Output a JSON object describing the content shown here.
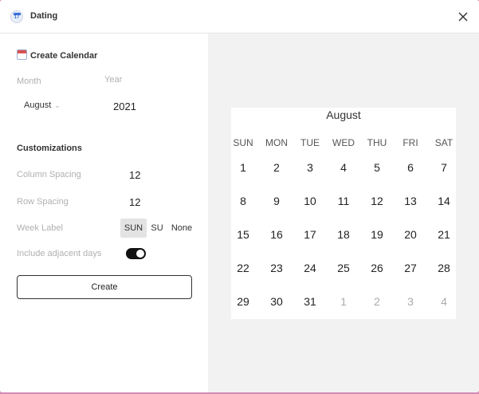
{
  "window": {
    "title": "Dating",
    "app_icon_text": "17"
  },
  "form": {
    "heading": "Create Calendar",
    "month_label": "Month",
    "year_label": "Year",
    "month_value": "August",
    "year_value": "2021",
    "customizations_heading": "Customizations",
    "column_spacing_label": "Column Spacing",
    "column_spacing_value": "12",
    "row_spacing_label": "Row Spacing",
    "row_spacing_value": "12",
    "week_label_label": "Week Label",
    "week_label_options": [
      "SUN",
      "SU",
      "None"
    ],
    "week_label_selected": "SUN",
    "adjacent_days_label": "Include adjacent days",
    "adjacent_days_enabled": true,
    "create_label": "Create"
  },
  "preview": {
    "month_title": "August",
    "weekdays": [
      "SUN",
      "MON",
      "TUE",
      "WED",
      "THU",
      "FRI",
      "SAT"
    ],
    "weeks": [
      [
        {
          "d": "1",
          "adj": false
        },
        {
          "d": "2",
          "adj": false
        },
        {
          "d": "3",
          "adj": false
        },
        {
          "d": "4",
          "adj": false
        },
        {
          "d": "5",
          "adj": false
        },
        {
          "d": "6",
          "adj": false
        },
        {
          "d": "7",
          "adj": false
        }
      ],
      [
        {
          "d": "8",
          "adj": false
        },
        {
          "d": "9",
          "adj": false
        },
        {
          "d": "10",
          "adj": false
        },
        {
          "d": "11",
          "adj": false
        },
        {
          "d": "12",
          "adj": false
        },
        {
          "d": "13",
          "adj": false
        },
        {
          "d": "14",
          "adj": false
        }
      ],
      [
        {
          "d": "15",
          "adj": false
        },
        {
          "d": "16",
          "adj": false
        },
        {
          "d": "17",
          "adj": false
        },
        {
          "d": "18",
          "adj": false
        },
        {
          "d": "19",
          "adj": false
        },
        {
          "d": "20",
          "adj": false
        },
        {
          "d": "21",
          "adj": false
        }
      ],
      [
        {
          "d": "22",
          "adj": false
        },
        {
          "d": "23",
          "adj": false
        },
        {
          "d": "24",
          "adj": false
        },
        {
          "d": "25",
          "adj": false
        },
        {
          "d": "26",
          "adj": false
        },
        {
          "d": "27",
          "adj": false
        },
        {
          "d": "28",
          "adj": false
        }
      ],
      [
        {
          "d": "29",
          "adj": false
        },
        {
          "d": "30",
          "adj": false
        },
        {
          "d": "31",
          "adj": false
        },
        {
          "d": "1",
          "adj": true
        },
        {
          "d": "2",
          "adj": true
        },
        {
          "d": "3",
          "adj": true
        },
        {
          "d": "4",
          "adj": true
        }
      ]
    ]
  },
  "colors": {
    "background": "#d58ab3",
    "preview_bg": "#f2f2f2",
    "toggle_on": "#111111"
  }
}
